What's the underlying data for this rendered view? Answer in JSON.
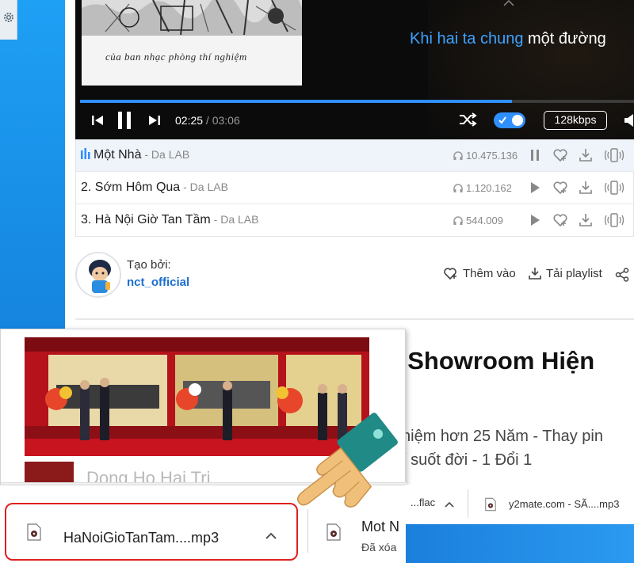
{
  "player": {
    "cover_caption": "của ban nhạc phòng thí nghiệm",
    "lyric_highlight": "Khi hai ta chung",
    "lyric_rest": " một đường",
    "time_current": "02:25",
    "time_separator": " / ",
    "time_total": "03:06",
    "progress_fraction": 0.78,
    "quality_label": "128kbps",
    "repeat_toggle_on": true,
    "accent_color": "#2f8fff"
  },
  "songs": [
    {
      "title": "Một Nhà",
      "separator": " - ",
      "artist": "Da LAB",
      "plays": "10.475.136",
      "playing": true
    },
    {
      "title": "2. Sớm Hôm Qua",
      "separator": " - ",
      "artist": "Da LAB",
      "plays": "1.120.162",
      "playing": false
    },
    {
      "title": "3. Hà Nội Giờ Tan Tầm",
      "separator": " - ",
      "artist": "Da LAB",
      "plays": "544.009",
      "playing": false
    }
  ],
  "creator": {
    "label": "Tạo bởi:",
    "name": "nct_official"
  },
  "actions": {
    "add_label": "Thêm vào",
    "download_playlist_label": "Tải playlist"
  },
  "ad": {
    "headline": "i Showroom Hiện",
    "sub1": "hiệm hơn 25 Năm - Thay pin",
    "sub2": "í suốt đời - 1 Đổi 1"
  },
  "popup": {
    "text": "Dong Ho Hai Tri"
  },
  "downloads": {
    "main_file": "HaNoiGioTanTam....mp3",
    "second_file": "Mot N",
    "second_status": "Đã xóa",
    "top_item_1": "...flac",
    "top_item_2": "y2mate.com - SÃ....mp3"
  }
}
